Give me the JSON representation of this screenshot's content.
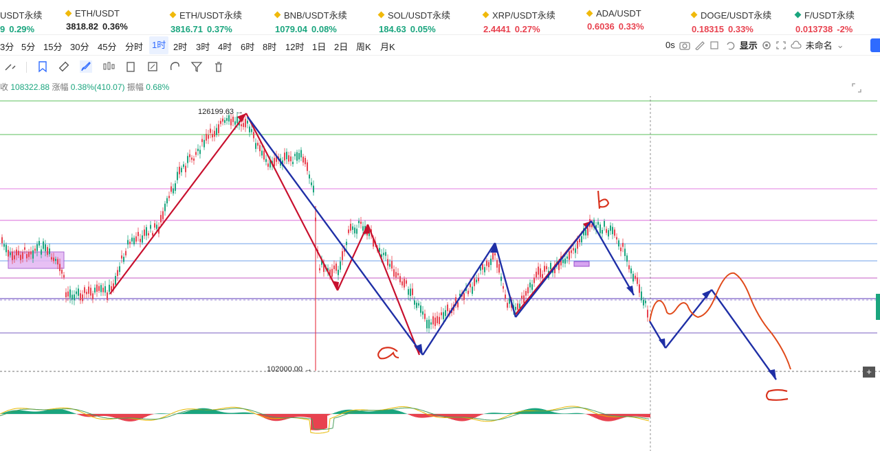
{
  "tickers": [
    {
      "name": "USDT永续",
      "price": "",
      "change": "0.29%",
      "price_tone": "up",
      "change_tone": "up",
      "price_prefix": "9"
    },
    {
      "name": "ETH/USDT",
      "price": "3818.82",
      "change": "0.36%",
      "price_tone": "dark",
      "change_tone": "dark"
    },
    {
      "name": "ETH/USDT永续",
      "price": "3816.71",
      "change": "0.37%",
      "price_tone": "up",
      "change_tone": "up"
    },
    {
      "name": "BNB/USDT永续",
      "price": "1079.04",
      "change": "0.08%",
      "price_tone": "up",
      "change_tone": "up"
    },
    {
      "name": "SOL/USDT永续",
      "price": "184.63",
      "change": "0.05%",
      "price_tone": "up",
      "change_tone": "up"
    },
    {
      "name": "XRP/USDT永续",
      "price": "2.4441",
      "change": "0.27%",
      "price_tone": "down",
      "change_tone": "down"
    },
    {
      "name": "ADA/USDT",
      "price": "0.6036",
      "change": "0.33%",
      "price_tone": "down",
      "change_tone": "down"
    },
    {
      "name": "DOGE/USDT永续",
      "price": "0.18315",
      "change": "0.33%",
      "price_tone": "down",
      "change_tone": "down"
    },
    {
      "name": "F/USDT永续",
      "price": "0.013738",
      "change": "-2%",
      "price_tone": "down",
      "change_tone": "down"
    }
  ],
  "timeframes": [
    "3分",
    "5分",
    "15分",
    "30分",
    "45分",
    "分时",
    "1时",
    "2时",
    "3时",
    "4时",
    "6时",
    "8时",
    "12时",
    "1日",
    "2日",
    "周K",
    "月K"
  ],
  "active_timeframe": "1时",
  "right_tools": {
    "countdown": "0s",
    "display": "显示",
    "layout_name": "未命名"
  },
  "stats": {
    "close_label": "收",
    "close_value": "108322.88",
    "change_label": "涨幅",
    "change_value": "0.38%(410.07)",
    "amp_label": "振幅",
    "amp_value": "0.68%"
  },
  "price_labels": {
    "high": "126199.63",
    "low": "102000.00"
  },
  "annotations": {
    "a": "a",
    "b": "b",
    "c": "c"
  },
  "colors": {
    "up": "#1aa57e",
    "down": "#e8424f",
    "accent": "#2f6bff",
    "blue_arrow": "#1f2fa6",
    "red_arrow": "#c8102e",
    "orange_line": "#e04a1a"
  },
  "icons": [
    "magnet-icon",
    "bookmark-icon",
    "ruler-icon",
    "brush-icon",
    "candles-icon",
    "trash-icon",
    "camera-icon",
    "settings-icon",
    "expand-icon",
    "cloud-icon"
  ],
  "chart_data": {
    "type": "candlestick",
    "title": "",
    "price_markers": [
      126199.63,
      102000.0
    ],
    "waves": [
      {
        "label": "a"
      },
      {
        "label": "b"
      },
      {
        "label": "c"
      }
    ]
  }
}
